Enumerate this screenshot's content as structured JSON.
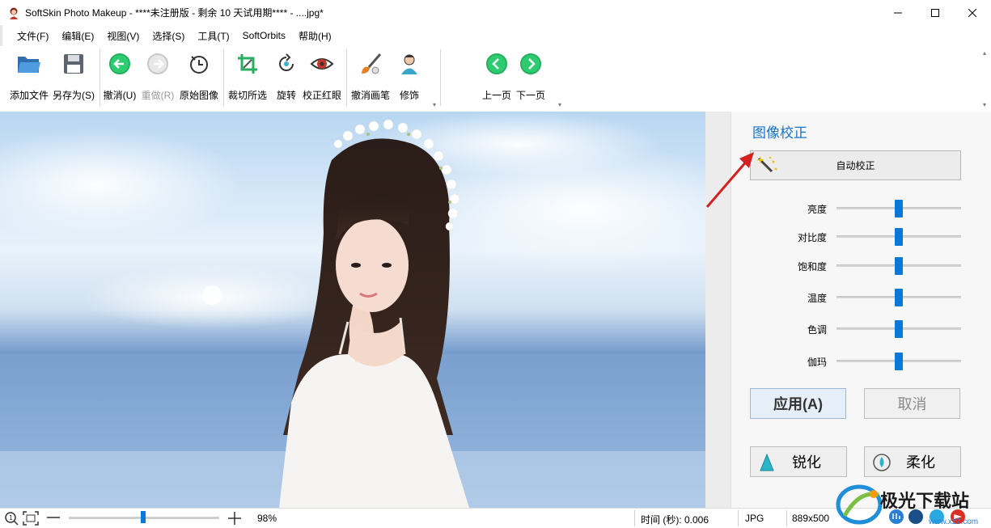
{
  "window": {
    "title": "SoftSkin Photo Makeup - ****未注册版 - 剩余 10 天试用期**** - ....jpg*"
  },
  "menu": [
    "文件(F)",
    "编辑(E)",
    "视图(V)",
    "选择(S)",
    "工具(T)",
    "SoftOrbits",
    "帮助(H)"
  ],
  "toolbar": {
    "add_file": "添加文件",
    "save_as": "另存为(S)",
    "undo": "撤消(U)",
    "redo": "重做(R)",
    "original": "原始图像",
    "crop": "裁切所选",
    "rotate": "旋转",
    "red_eye": "校正红眼",
    "undo_brush": "撤消画笔",
    "retouch": "修饰",
    "prev_page": "上一页",
    "next_page": "下一页"
  },
  "panel": {
    "title": "图像校正",
    "auto_correct": "自动校正",
    "sliders": [
      {
        "label": "亮度",
        "value": 0.5
      },
      {
        "label": "对比度",
        "value": 0.5
      },
      {
        "label": "饱和度",
        "value": 0.5
      },
      {
        "label": "温度",
        "value": 0.5
      },
      {
        "label": "色调",
        "value": 0.5
      },
      {
        "label": "伽玛",
        "value": 0.5
      }
    ],
    "apply": "应用(A)",
    "cancel": "取消",
    "sharpen": "锐化",
    "soften": "柔化"
  },
  "status": {
    "zoom_percent": "98%",
    "zoom_level": 0.48,
    "time": "时间 (秒): 0.006",
    "format": "JPG",
    "dimensions": "889x500"
  },
  "watermark": {
    "brand": "极光下载站",
    "url": "www.xz7.com"
  },
  "colors": {
    "accent": "#0a78d7",
    "panel_title": "#1a73c8",
    "arrow": "#d42020"
  }
}
